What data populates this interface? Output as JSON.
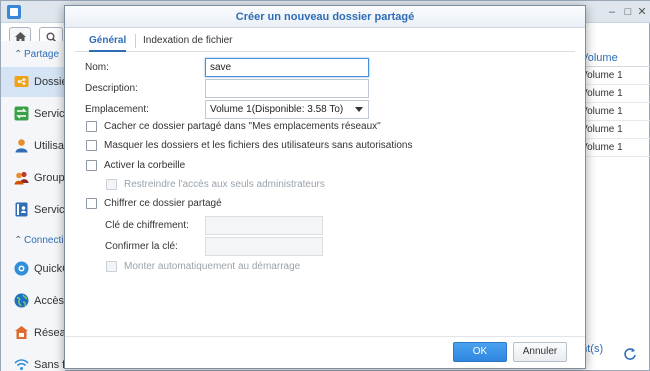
{
  "background": {
    "sidebar": {
      "sections": [
        {
          "label": "Partage"
        },
        {
          "label": "Connecti"
        }
      ],
      "items": [
        {
          "label": "Dossie",
          "icon": "shared-folder-icon",
          "active": true
        },
        {
          "label": "Service",
          "icon": "network-service-icon"
        },
        {
          "label": "Utilisat",
          "icon": "user-icon"
        },
        {
          "label": "Groupe",
          "icon": "group-icon"
        },
        {
          "label": "Service",
          "icon": "directory-service-icon"
        },
        {
          "label": "QuickC",
          "icon": "quickconnect-icon"
        },
        {
          "label": "Accès e",
          "icon": "external-access-icon"
        },
        {
          "label": "Réseau",
          "icon": "network-icon"
        },
        {
          "label": "Sans fi",
          "icon": "wireless-icon"
        }
      ]
    },
    "table": {
      "column_header": "Volume",
      "rows": [
        "Volume 1",
        "Volume 1",
        "Volume 1",
        "Volume 1",
        "Volume 1"
      ]
    },
    "status_text": "ent(s)"
  },
  "dialog": {
    "title": "Créer un nouveau dossier partagé",
    "tabs": [
      {
        "label": "Général",
        "active": true
      },
      {
        "label": "Indexation de fichier",
        "active": false
      }
    ],
    "fields": {
      "name_label": "Nom:",
      "name_value": "save",
      "description_label": "Description:",
      "description_value": "",
      "location_label": "Emplacement:",
      "location_value": "Volume 1(Disponible: 3.58 To)"
    },
    "checkboxes": {
      "hide_share": "Cacher ce dossier partagé dans \"Mes emplacements réseaux\"",
      "hide_unauthorized": "Masquer les dossiers et les fichiers des utilisateurs sans autorisations",
      "recycle_bin": "Activer la corbeille",
      "restrict_admins": "Restreindre l'accès aux seuls administrateurs",
      "encrypt": "Chiffrer ce dossier partagé",
      "automount": "Monter automatiquement au démarrage"
    },
    "encryption": {
      "key_label": "Clé de chiffrement:",
      "confirm_label": "Confirmer la clé:"
    },
    "buttons": {
      "ok": "OK",
      "cancel": "Annuler"
    },
    "colors": {
      "accent": "#2f6db6",
      "primary_button": "#2e86df"
    }
  }
}
